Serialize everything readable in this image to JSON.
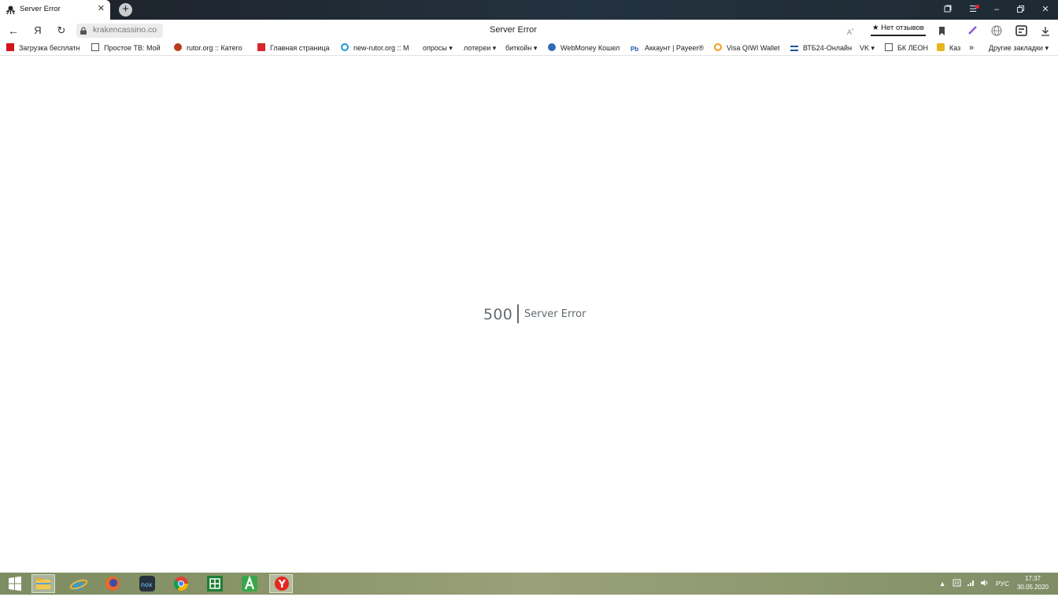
{
  "browser": {
    "tab": {
      "title": "Server Error",
      "favicon": "kraken-icon"
    },
    "window_controls": [
      "tabs-icon",
      "menu-icon",
      "minimize-icon",
      "restore-icon",
      "close-icon"
    ],
    "address": {
      "url": "krakencassino.co"
    },
    "page_title": "Server Error",
    "reviews_label": "★ Нет отзывов",
    "bookmarks": [
      {
        "label": "Загрузка бесплатн",
        "icon": "adobe-icon"
      },
      {
        "label": "Простое ТВ: Мой ",
        "icon": "page-icon"
      },
      {
        "label": "rutor.org :: Катего",
        "icon": "rutor-icon"
      },
      {
        "label": "Главная страница",
        "icon": "bank-icon"
      },
      {
        "label": "new-rutor.org :: М",
        "icon": "rutor-new-icon"
      },
      {
        "label": "опросы ▾",
        "icon": ""
      },
      {
        "label": "лотереи ▾",
        "icon": ""
      },
      {
        "label": "биткойн ▾",
        "icon": ""
      },
      {
        "label": "WebMoney Кошел",
        "icon": "webmoney-icon"
      },
      {
        "label": "Аккаунт | Payeer®",
        "icon": "payeer-icon"
      },
      {
        "label": "Visa QIWI Wallet",
        "icon": "qiwi-icon"
      },
      {
        "label": "ВТБ24-Онлайн",
        "icon": "vtb-icon"
      },
      {
        "label": "VK ▾",
        "icon": ""
      },
      {
        "label": "БК ЛЕОН",
        "icon": "page-icon"
      },
      {
        "label": "Каз",
        "icon": "casino-icon"
      }
    ],
    "more_bookmarks": "»",
    "other_bookmarks": "Другие закладки ▾"
  },
  "page": {
    "error_code": "500",
    "error_message": "Server Error"
  },
  "taskbar": {
    "apps": [
      "windows-start-icon",
      "file-explorer-icon",
      "internet-explorer-icon",
      "firefox-icon",
      "nox-icon",
      "chrome-icon",
      "excel-icon",
      "android-studio-icon",
      "yandex-browser-icon"
    ],
    "language": "РУС",
    "time": "17:37",
    "date": "30.05.2020"
  },
  "colors": {
    "error_text": "#636b6f",
    "tabstrip": "#1d2128",
    "taskbar": "#8a9568"
  }
}
